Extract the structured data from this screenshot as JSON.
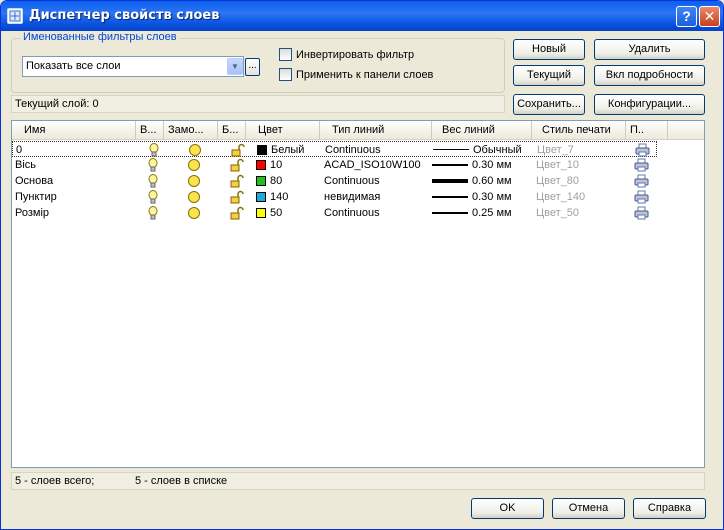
{
  "window": {
    "title": "Диспетчер свойств слоев",
    "help_label": "?",
    "close_label": "✕"
  },
  "filters": {
    "group_title": "Именованные фильтры слоев",
    "selected_value": "Показать все слои",
    "dots_label": "...",
    "invert_label": "Инвертировать фильтр",
    "apply_label": "Применить к панели слоев"
  },
  "buttons": {
    "new": "Новый",
    "delete": "Удалить",
    "current": "Текущий",
    "details": "Вкл подробности",
    "save": "Сохранить...",
    "config": "Конфигурации...",
    "ok": "OK",
    "cancel": "Отмена",
    "help": "Справка"
  },
  "current_layer": "Текущий слой:  0",
  "columns": [
    "Имя",
    "В...",
    "Замо...",
    "Б...",
    "Цвет",
    "Тип линий",
    "Вес линий",
    "Стиль печати",
    "П.."
  ],
  "layers": [
    {
      "name": "0",
      "color_name": "Белый",
      "color_hex": "#000000",
      "linetype": "Continuous",
      "lineweight": "Обычный",
      "lw_thickness": 1,
      "plot_style": "Цвет_7"
    },
    {
      "name": "Вісь",
      "color_name": "10",
      "color_hex": "#ff0000",
      "linetype": "ACAD_ISO10W100",
      "lineweight": "0.30 мм",
      "lw_thickness": 2,
      "plot_style": "Цвет_10"
    },
    {
      "name": "Основа",
      "color_name": "80",
      "color_hex": "#20c020",
      "linetype": "Continuous",
      "lineweight": "0.60 мм",
      "lw_thickness": 4,
      "plot_style": "Цвет_80"
    },
    {
      "name": "Пунктир",
      "color_name": "140",
      "color_hex": "#20a8e0",
      "linetype": "невидимая",
      "lineweight": "0.30 мм",
      "lw_thickness": 2,
      "plot_style": "Цвет_140"
    },
    {
      "name": "Розмір",
      "color_name": "50",
      "color_hex": "#ffff00",
      "linetype": "Continuous",
      "lineweight": "0.25 мм",
      "lw_thickness": 2,
      "plot_style": "Цвет_50"
    }
  ],
  "status": {
    "total": "5 - слоев всего;",
    "listed": "5 - слоев в списке"
  }
}
